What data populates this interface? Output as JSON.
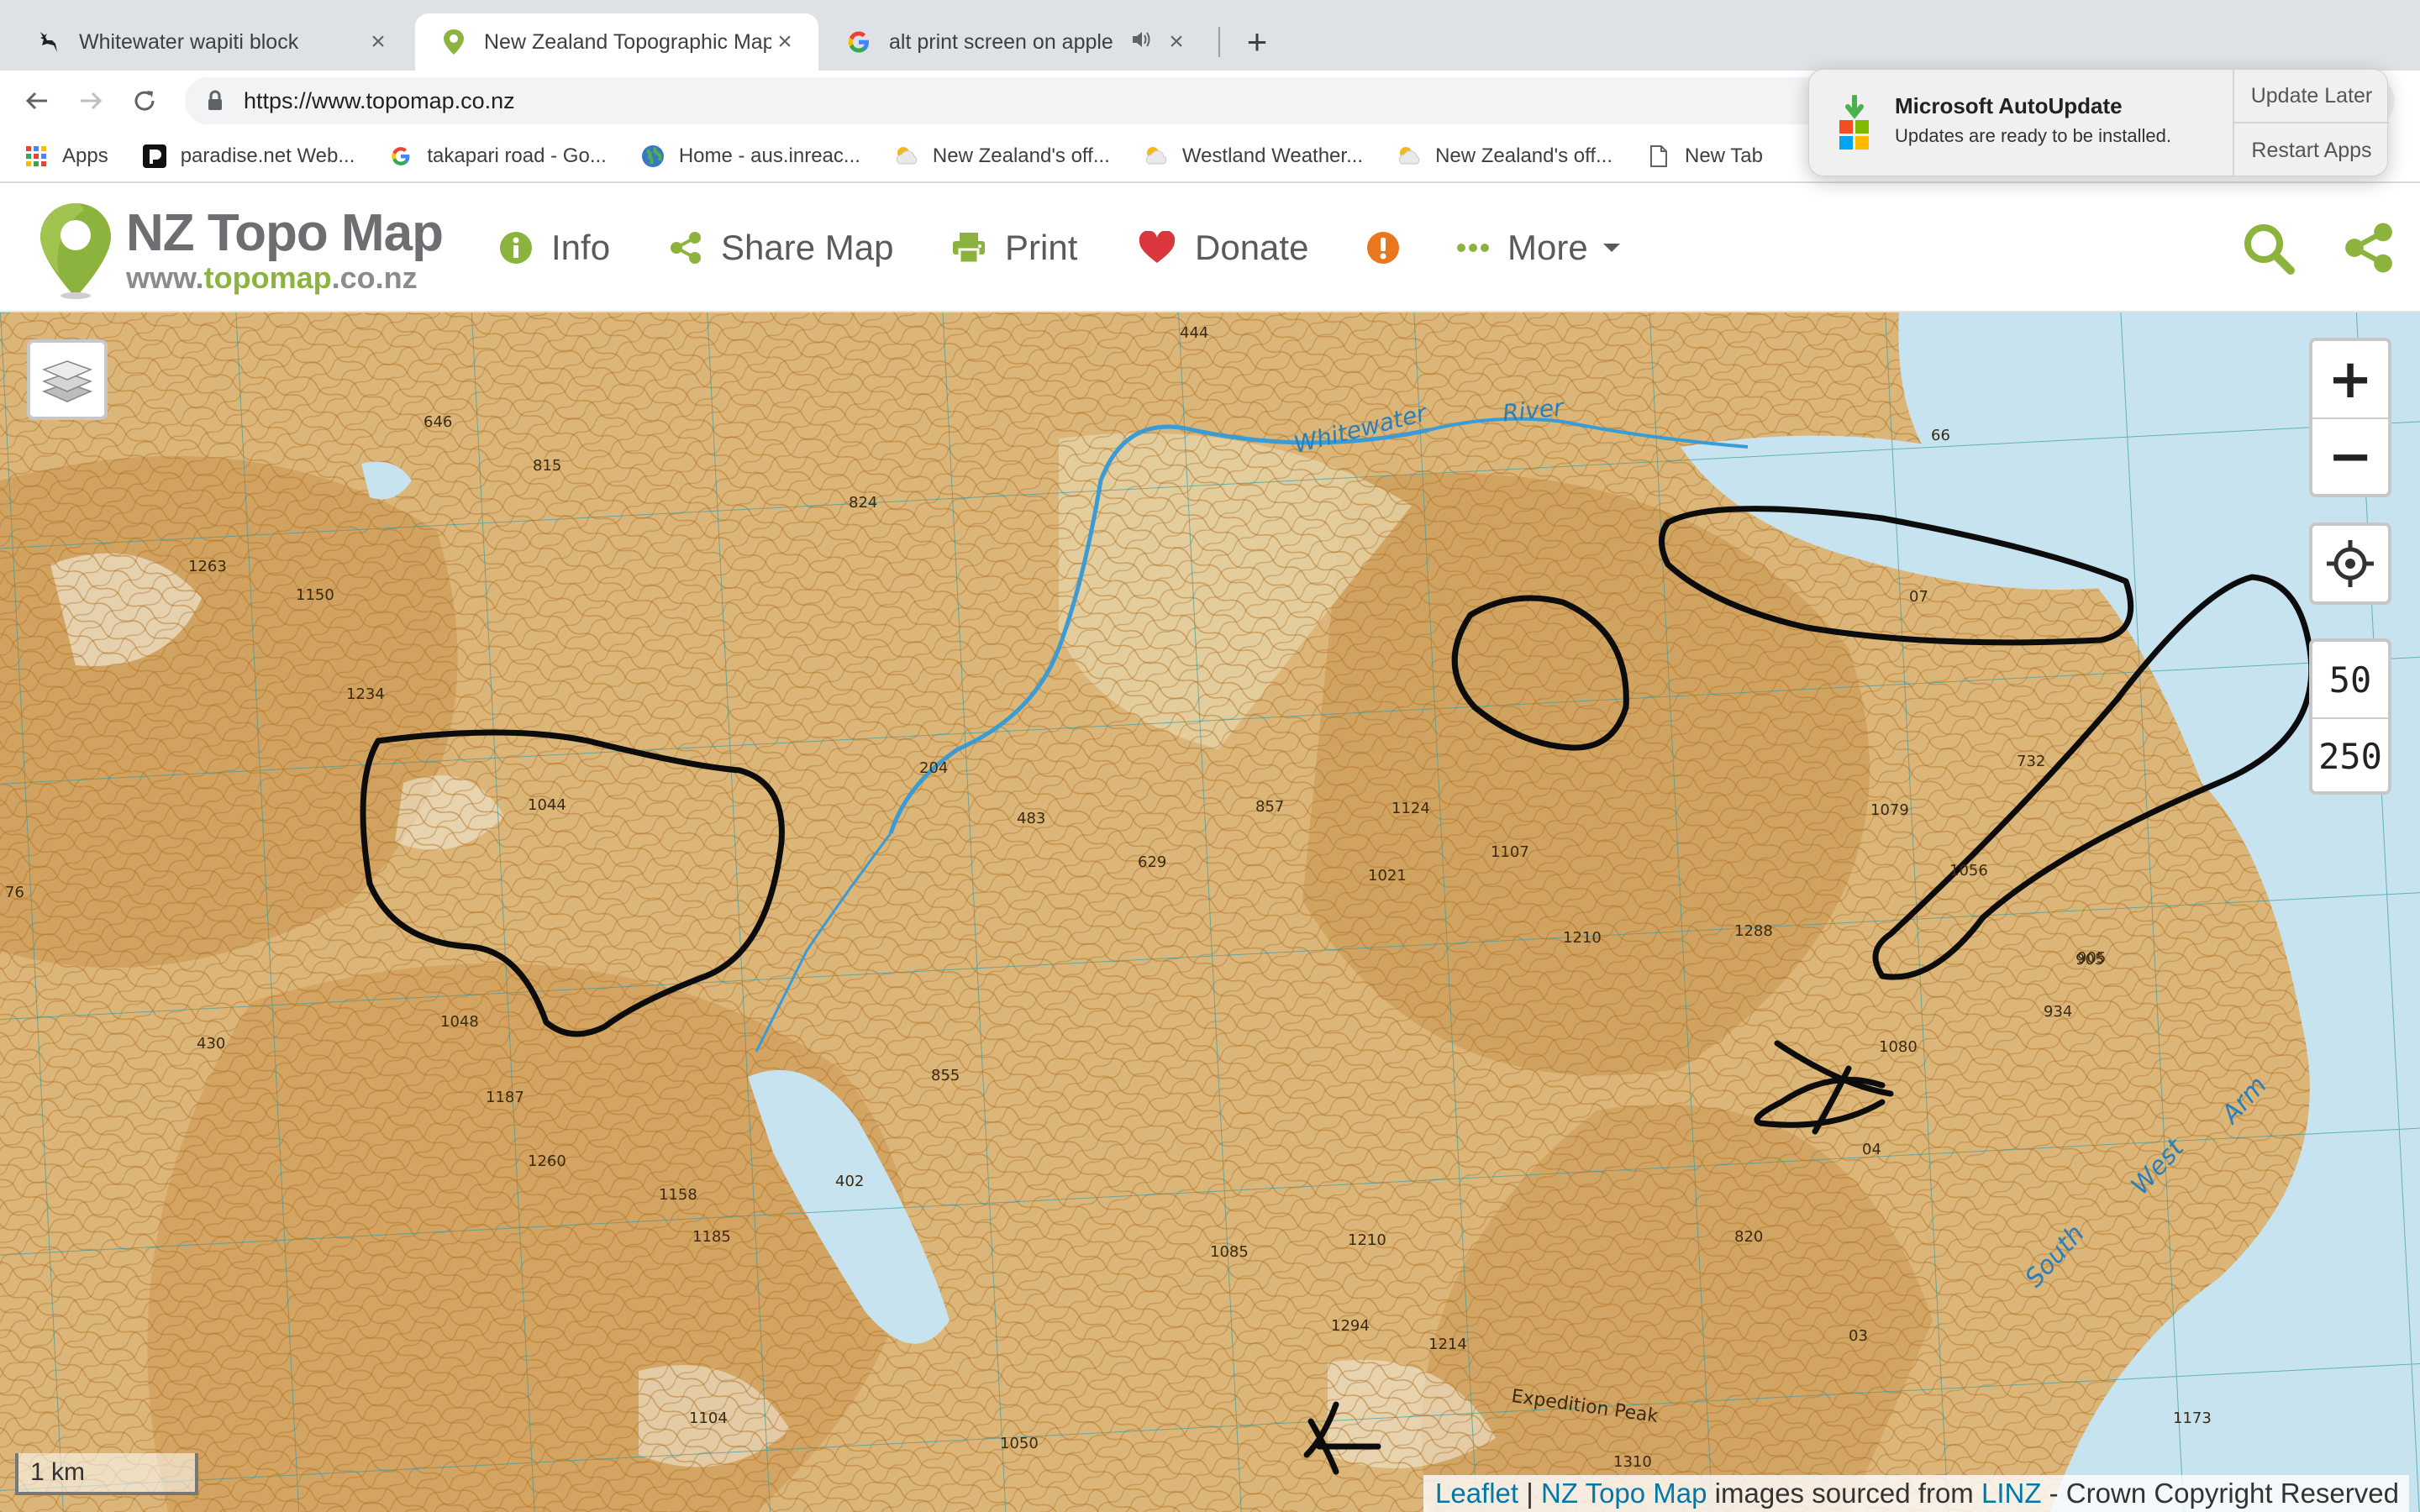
{
  "browser": {
    "tabs": [
      {
        "title": "Whitewater wapiti block",
        "favicon": "deer-icon",
        "active": false
      },
      {
        "title": "New Zealand Topographic Map",
        "favicon": "map-pin-icon",
        "active": true
      },
      {
        "title": "alt print screen on apple ke",
        "favicon": "google-icon",
        "active": false,
        "audio": true
      }
    ],
    "close_glyph": "×",
    "new_tab_glyph": "+",
    "url": "https://www.topomap.co.nz",
    "bookmarks": [
      {
        "label": "Apps",
        "icon": "apps-grid-icon"
      },
      {
        "label": "paradise.net Web...",
        "icon": "paradise-icon"
      },
      {
        "label": "takapari road - Go...",
        "icon": "google-icon"
      },
      {
        "label": "Home - aus.inreac...",
        "icon": "globe-icon"
      },
      {
        "label": "New Zealand's off...",
        "icon": "weather-icon"
      },
      {
        "label": "Westland Weather...",
        "icon": "weather-icon"
      },
      {
        "label": "New Zealand's off...",
        "icon": "weather-icon"
      },
      {
        "label": "New Tab",
        "icon": "page-icon"
      }
    ]
  },
  "site": {
    "logo_title": "NZ Topo Map",
    "logo_url_prefix": "www.",
    "logo_url_highlight": "topomap",
    "logo_url_suffix": ".co.nz",
    "menu": [
      {
        "label": "Info",
        "icon": "info-icon"
      },
      {
        "label": "Share Map",
        "icon": "share-icon"
      },
      {
        "label": "Print",
        "icon": "printer-icon"
      },
      {
        "label": "Donate",
        "icon": "heart-icon"
      },
      {
        "label": "",
        "icon": "alert-icon"
      },
      {
        "label": "More",
        "icon": "ellipsis-icon"
      }
    ],
    "brand_green": "#8cb33d",
    "donate_red": "#d9363e",
    "alert_orange": "#e8771e"
  },
  "map": {
    "zoom_in": "+",
    "zoom_out": "−",
    "scales": [
      "50",
      "250"
    ],
    "scale_bar": "1 km",
    "attribution": {
      "leaflet": "Leaflet",
      "sep": " | ",
      "nztopo": "NZ Topo Map",
      "mid": " images sourced from ",
      "linz": "LINZ",
      "end": " - Crown Copyright Reserved"
    },
    "labels": [
      {
        "text": "Whitewater",
        "kind": "river"
      },
      {
        "text": "River",
        "kind": "river"
      },
      {
        "text": "South",
        "kind": "water"
      },
      {
        "text": "West",
        "kind": "water"
      },
      {
        "text": "Arm",
        "kind": "water"
      },
      {
        "text": "Expedition Peak",
        "kind": "peak"
      },
      {
        "text": "444"
      },
      {
        "text": "646"
      },
      {
        "text": "815"
      },
      {
        "text": "824"
      },
      {
        "text": "1263"
      },
      {
        "text": "1150"
      },
      {
        "text": "1234"
      },
      {
        "text": "1044"
      },
      {
        "text": "1048"
      },
      {
        "text": "1187"
      },
      {
        "text": "1260"
      },
      {
        "text": "1158"
      },
      {
        "text": "1185"
      },
      {
        "text": "1085"
      },
      {
        "text": "1210"
      },
      {
        "text": "1294"
      },
      {
        "text": "1214"
      },
      {
        "text": "1104"
      },
      {
        "text": "1050"
      },
      {
        "text": "1310"
      },
      {
        "text": "905"
      },
      {
        "text": "204"
      },
      {
        "text": "483"
      },
      {
        "text": "629"
      },
      {
        "text": "857"
      },
      {
        "text": "1124"
      },
      {
        "text": "1107"
      },
      {
        "text": "1021"
      },
      {
        "text": "1210"
      },
      {
        "text": "1288"
      },
      {
        "text": "1079"
      },
      {
        "text": "1056"
      },
      {
        "text": "732"
      },
      {
        "text": "905"
      },
      {
        "text": "934"
      },
      {
        "text": "1080"
      },
      {
        "text": "820"
      },
      {
        "text": "855"
      },
      {
        "text": "402"
      },
      {
        "text": "430"
      },
      {
        "text": "66"
      },
      {
        "text": "07"
      },
      {
        "text": "04"
      },
      {
        "text": "03"
      },
      {
        "text": "1173"
      },
      {
        "text": "76"
      }
    ]
  },
  "notification": {
    "title": "Microsoft AutoUpdate",
    "body": "Updates are ready to be installed.",
    "update_later": "Update Later",
    "restart_apps": "Restart Apps"
  }
}
